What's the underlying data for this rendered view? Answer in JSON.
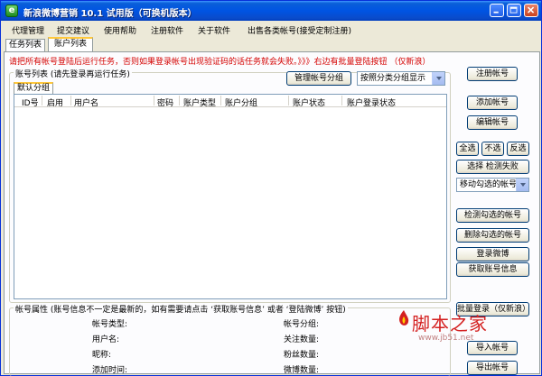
{
  "window": {
    "title": "新浪微博营销 10.1 试用版（可换机版本）",
    "icon": "app-e-icon",
    "controls": [
      "minimize-icon",
      "maximize-icon",
      "close-icon"
    ]
  },
  "menu": {
    "items": [
      "代理管理",
      "提交建议",
      "使用帮助",
      "注册软件",
      "关于软件",
      "出售各类帐号(接受定制注册)"
    ]
  },
  "tabs": {
    "items": [
      "任务列表",
      "账户列表"
    ],
    "active": "账户列表"
  },
  "notice": "请把所有帐号登陆后运行任务，否则如果登录帐号出现验证码的话任务就会失败。》》》右边有批量登陆按钮 （仅新浪）",
  "account_list": {
    "legend": "账号列表 (请先登录再运行任务)",
    "manage_group_button": "管理帐号分组",
    "group_display_select": "按照分类分组显示",
    "subtab": "默认分组",
    "columns": [
      "ID号",
      "启用",
      "用户名",
      "密码",
      "账户类型",
      "账户分组",
      "账户状态",
      "账户登录状态"
    ]
  },
  "attributes": {
    "legend": "帐号属性 (账号信息不一定是最新的，如有需要请点击 ‘获取账号信息’ 或者 ‘登陆微博’ 按钮)",
    "left_labels": [
      "帐号类型:",
      "用户名:",
      "昵称:",
      "添加时间:"
    ],
    "right_labels": [
      "帐号分组:",
      "关注数量:",
      "粉丝数量:",
      "微博数量:"
    ]
  },
  "side_buttons": {
    "register": "注册帐号",
    "add": "添加帐号",
    "edit": "编辑帐号",
    "select_all": "全选",
    "select_none": "不选",
    "select_invert": "反选",
    "select_failed": "选择 检测失败",
    "move_select": "移动勾选的帐号",
    "check_selected": "检测勾选的帐号",
    "delete_selected": "删除勾选的帐号",
    "login_weibo": "登录微博",
    "get_info": "获取账号信息",
    "batch_login": "批量登录（仅新浪）",
    "import": "导入帐号",
    "export": "导出帐号"
  },
  "watermark": {
    "text": "脚本之家",
    "url": "www.jb51.net"
  }
}
